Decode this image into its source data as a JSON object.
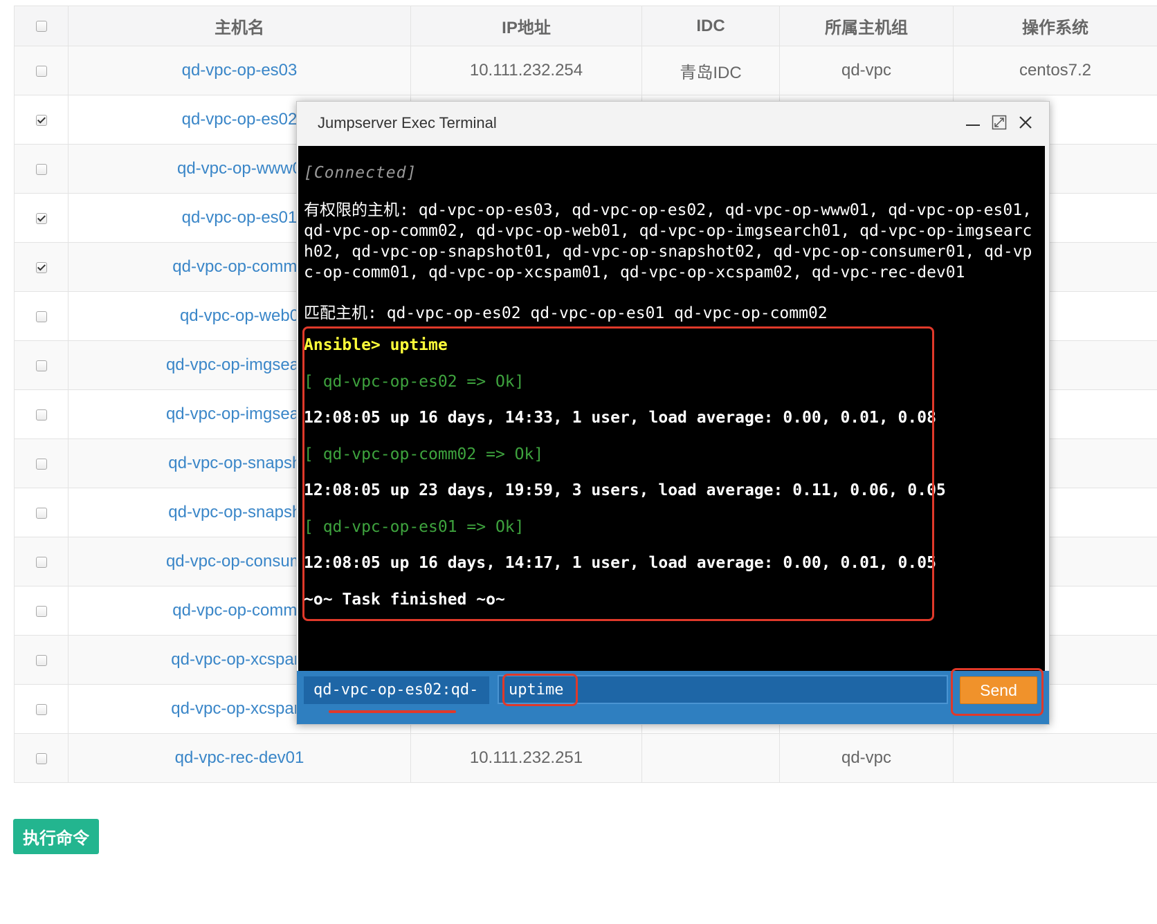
{
  "table": {
    "headers": {
      "host": "主机名",
      "ip": "IP地址",
      "idc": "IDC",
      "group": "所属主机组",
      "os": "操作系统"
    },
    "rows": [
      {
        "host": "qd-vpc-op-es03",
        "ip": "10.111.232.254",
        "idc": "青岛IDC",
        "group": "qd-vpc",
        "os": "centos7.2",
        "checked": false
      },
      {
        "host": "qd-vpc-op-es02",
        "ip": "",
        "idc": "",
        "group": "",
        "os": "",
        "checked": true
      },
      {
        "host": "qd-vpc-op-www0",
        "ip": "",
        "idc": "",
        "group": "",
        "os": "",
        "checked": false
      },
      {
        "host": "qd-vpc-op-es01",
        "ip": "",
        "idc": "",
        "group": "",
        "os": "",
        "checked": true
      },
      {
        "host": "qd-vpc-op-comm0",
        "ip": "",
        "idc": "",
        "group": "",
        "os": "",
        "checked": true
      },
      {
        "host": "qd-vpc-op-web0",
        "ip": "",
        "idc": "",
        "group": "",
        "os": "",
        "checked": false
      },
      {
        "host": "qd-vpc-op-imgsearc",
        "ip": "",
        "idc": "",
        "group": "",
        "os": "",
        "checked": false
      },
      {
        "host": "qd-vpc-op-imgsearc",
        "ip": "",
        "idc": "",
        "group": "",
        "os": "",
        "checked": false
      },
      {
        "host": "qd-vpc-op-snapsho",
        "ip": "",
        "idc": "",
        "group": "",
        "os": "",
        "checked": false
      },
      {
        "host": "qd-vpc-op-snapsho",
        "ip": "",
        "idc": "",
        "group": "",
        "os": "",
        "checked": false
      },
      {
        "host": "qd-vpc-op-consume",
        "ip": "",
        "idc": "",
        "group": "",
        "os": "",
        "checked": false
      },
      {
        "host": "qd-vpc-op-comm0",
        "ip": "",
        "idc": "",
        "group": "",
        "os": "",
        "checked": false
      },
      {
        "host": "qd-vpc-op-xcspam",
        "ip": "",
        "idc": "",
        "group": "",
        "os": "",
        "checked": false
      },
      {
        "host": "qd-vpc-op-xcspam",
        "ip": "",
        "idc": "",
        "group": "",
        "os": "",
        "checked": false
      },
      {
        "host": "qd-vpc-rec-dev01",
        "ip": "10.111.232.251",
        "idc": "",
        "group": "qd-vpc",
        "os": "",
        "checked": false
      }
    ]
  },
  "exec_button_label": "执行命令",
  "dialog": {
    "title": "Jumpserver Exec Terminal",
    "controls": {
      "minimize_icon": "minimize-icon",
      "maximize_icon": "maximize-icon",
      "close_icon": "close-icon"
    },
    "terminal": {
      "connected": "[Connected]",
      "permitted_hosts": "有权限的主机: qd-vpc-op-es03, qd-vpc-op-es02, qd-vpc-op-www01, qd-vpc-op-es01, qd-vpc-op-comm02, qd-vpc-op-web01, qd-vpc-op-imgsearch01, qd-vpc-op-imgsearch02, qd-vpc-op-snapshot01, qd-vpc-op-snapshot02, qd-vpc-op-consumer01, qd-vpc-op-comm01, qd-vpc-op-xcspam01, qd-vpc-op-xcspam02, qd-vpc-rec-dev01",
      "matched_hosts": "匹配主机: qd-vpc-op-es02 qd-vpc-op-es01 qd-vpc-op-comm02",
      "prompt": "Ansible>",
      "command": " uptime",
      "results": [
        {
          "status": "[ qd-vpc-op-es02 => Ok]",
          "output": "12:08:05 up 16 days, 14:33, 1 user, load average: 0.00, 0.01, 0.08"
        },
        {
          "status": "[ qd-vpc-op-comm02 => Ok]",
          "output": "12:08:05 up 23 days, 19:59, 3 users, load average: 0.11, 0.06, 0.05"
        },
        {
          "status": "[ qd-vpc-op-es01 => Ok]",
          "output": "12:08:05 up 16 days, 14:17, 1 user, load average: 0.00, 0.01, 0.05"
        }
      ],
      "finished": "~o~ Task finished ~o~"
    },
    "footer": {
      "host_selector": "qd-vpc-op-es02:qd-",
      "command_value": "uptime",
      "send_label": "Send"
    }
  },
  "colors": {
    "link": "#3a86c8",
    "exec_button": "#23b58f",
    "footer_bar": "#2f7fc0",
    "send_button": "#f0922b",
    "prompt": "#ffff3a",
    "ok_status": "#3ea33e",
    "highlight": "#e0392a"
  }
}
